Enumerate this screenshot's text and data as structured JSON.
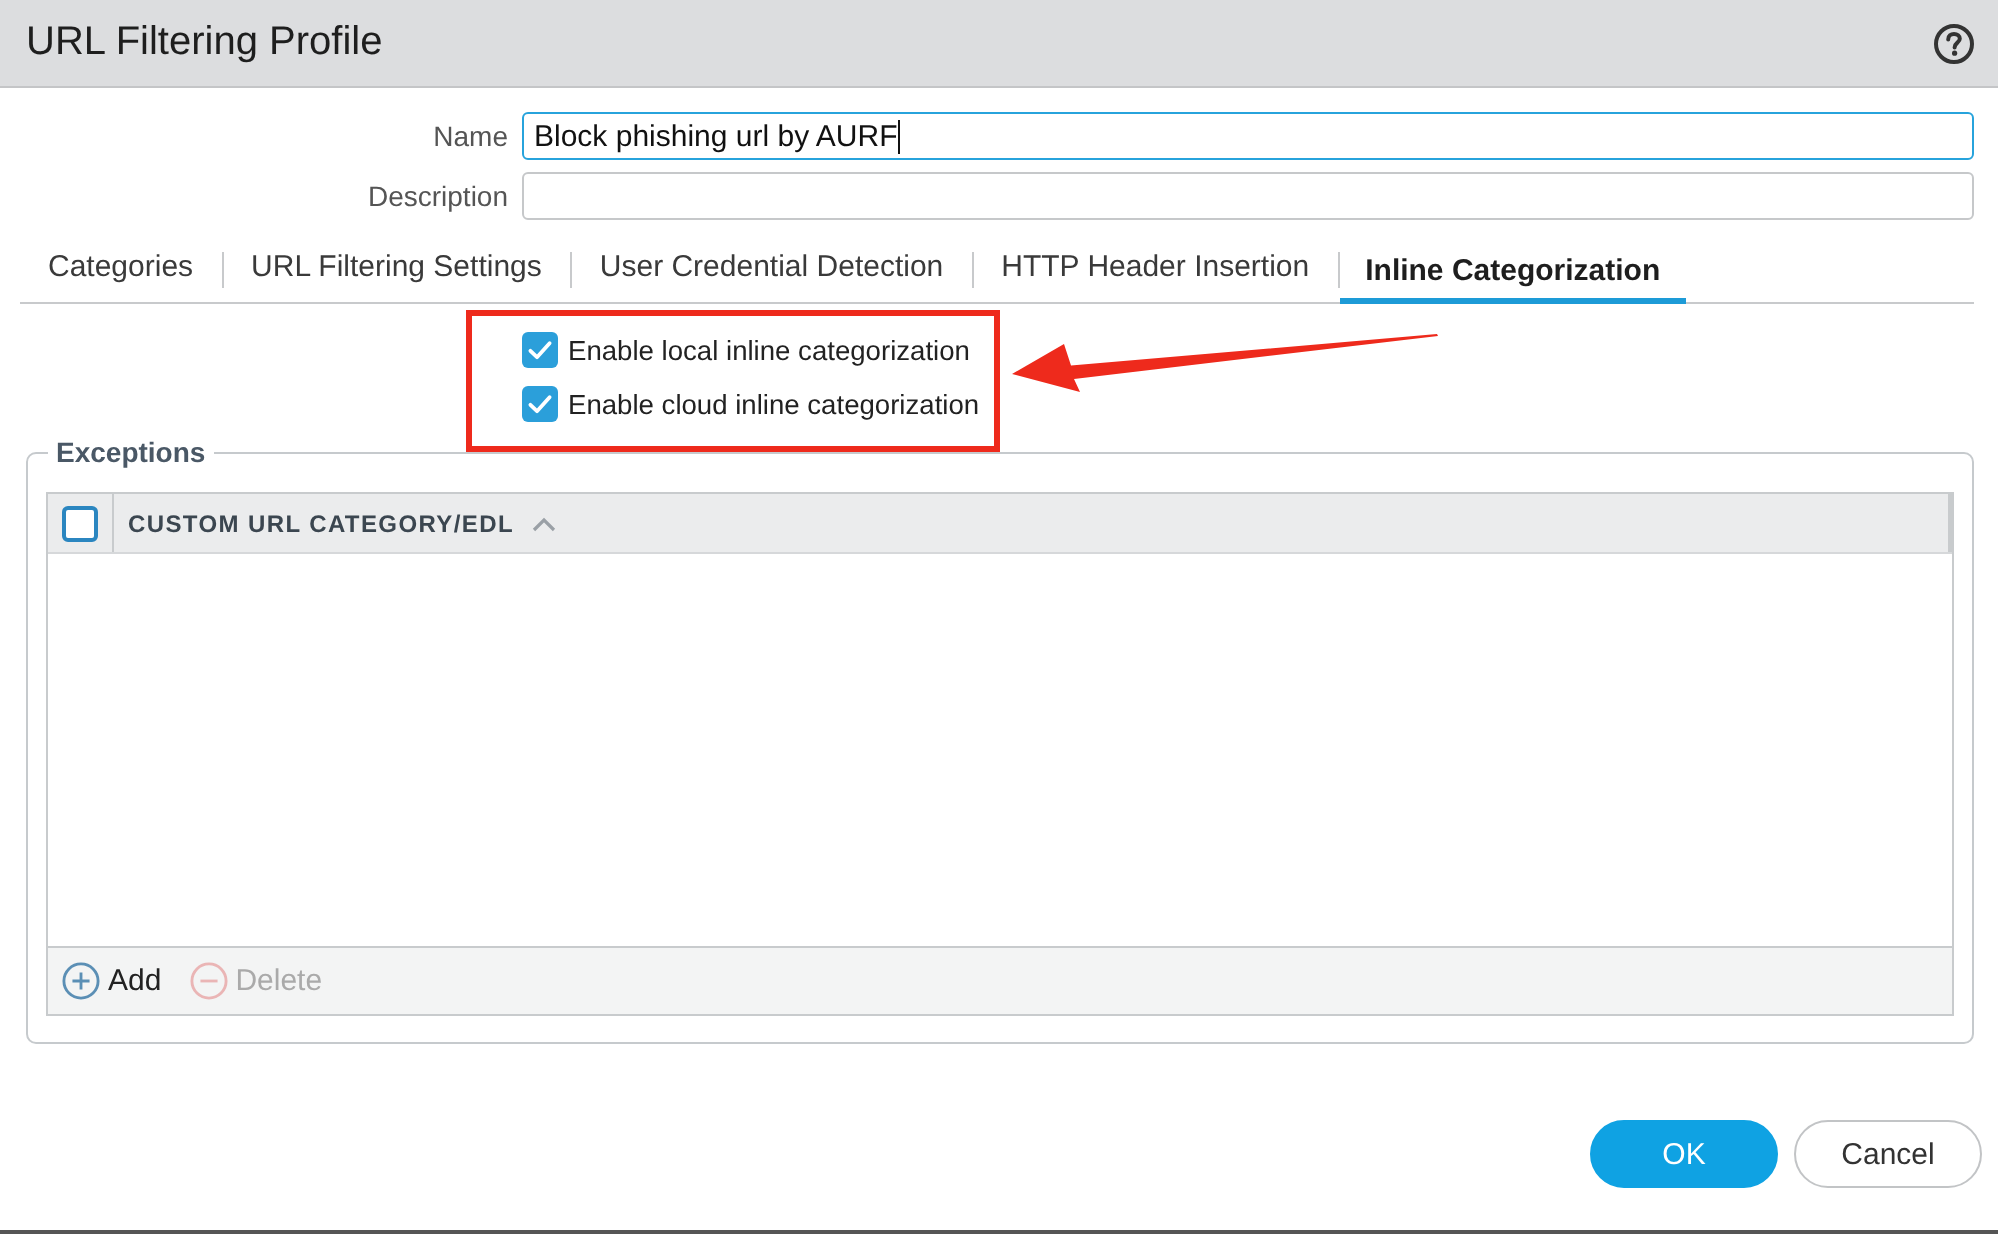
{
  "window": {
    "title": "URL Filtering Profile"
  },
  "form": {
    "fields": [
      {
        "label": "Name",
        "value": "Block phishing url by AURF",
        "focused": true
      },
      {
        "label": "Description",
        "focused": false
      }
    ]
  },
  "tabs": [
    {
      "label": "Categories",
      "selected": false
    },
    {
      "label": "URL Filtering Settings",
      "selected": false
    },
    {
      "label": "User Credential Detection",
      "selected": false
    },
    {
      "label": "HTTP Header Insertion",
      "selected": false
    },
    {
      "label": "Inline Categorization",
      "selected": true
    }
  ],
  "options": [
    {
      "label": "Enable local inline categorization",
      "checked": true
    },
    {
      "label": "Enable cloud inline categorization",
      "checked": true
    }
  ],
  "exceptions": {
    "title": "Exceptions",
    "table": {
      "select_all_checked": false,
      "columns": [
        {
          "label": "CUSTOM URL CATEGORY/EDL",
          "sort_ascending": true
        }
      ]
    },
    "actions": [
      {
        "label": "Add",
        "kind": "add",
        "disabled": false
      },
      {
        "label": "Delete",
        "kind": "delete",
        "disabled": true
      }
    ]
  },
  "buttons": [
    {
      "label": "OK",
      "kind": "primary"
    },
    {
      "label": "Cancel",
      "kind": "secondary"
    }
  ]
}
